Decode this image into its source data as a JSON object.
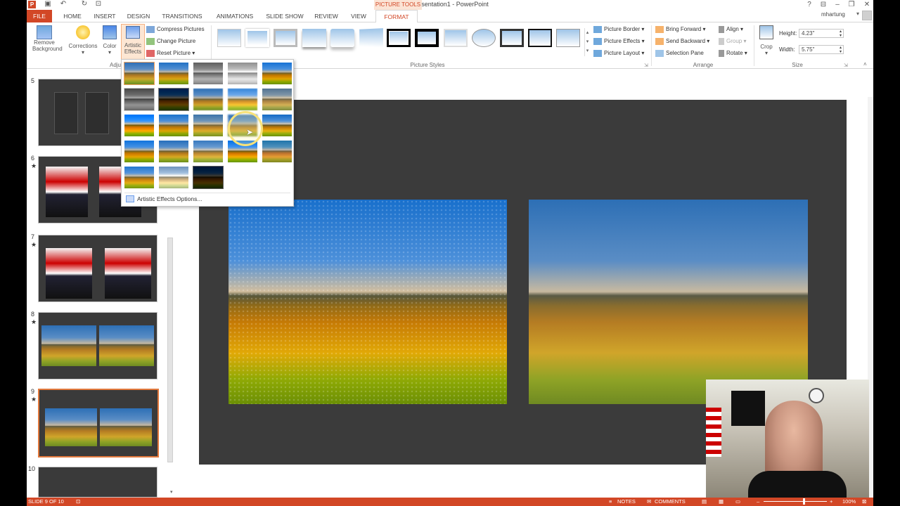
{
  "window": {
    "title": "Presentation1 - PowerPoint",
    "context_tab_group": "PICTURE TOOLS",
    "user": "mhartung",
    "help": "?",
    "minimize": "–",
    "restore": "❐",
    "close": "✕"
  },
  "tabs": [
    "FILE",
    "HOME",
    "INSERT",
    "DESIGN",
    "TRANSITIONS",
    "ANIMATIONS",
    "SLIDE SHOW",
    "REVIEW",
    "VIEW",
    "FORMAT"
  ],
  "ribbon": {
    "adjust": {
      "remove_background": "Remove\nBackground",
      "remove_bg_l1": "Remove",
      "remove_bg_l2": "Background",
      "corrections": "Corrections",
      "color": "Color",
      "artistic_l1": "Artistic",
      "artistic_l2": "Effects",
      "compress": "Compress Pictures",
      "change": "Change Picture",
      "reset": "Reset Picture",
      "group_label": "Adju"
    },
    "picture_styles": {
      "group_label": "Picture Styles",
      "border": "Picture Border",
      "effects": "Picture Effects",
      "layout": "Picture Layout"
    },
    "arrange": {
      "group_label": "Arrange",
      "bring_forward": "Bring Forward",
      "send_backward": "Send Backward",
      "selection_pane": "Selection Pane",
      "align": "Align",
      "group": "Group",
      "rotate": "Rotate"
    },
    "size": {
      "group_label": "Size",
      "crop": "Crop",
      "height_label": "Height:",
      "height_value": "4.23\"",
      "width_label": "Width:",
      "width_value": "5.75\""
    }
  },
  "artistic_effects": {
    "options_label": "Artistic Effects Options..."
  },
  "thumbnails": [
    {
      "num": "5",
      "star": ""
    },
    {
      "num": "6",
      "star": "★"
    },
    {
      "num": "7",
      "star": "★"
    },
    {
      "num": "8",
      "star": "★"
    },
    {
      "num": "9",
      "star": "★"
    },
    {
      "num": "10",
      "star": ""
    }
  ],
  "status": {
    "slide_info": "SLIDE 9 OF 10",
    "notes": "NOTES",
    "comments": "COMMENTS",
    "zoom": "100%"
  },
  "colors": {
    "accent": "#d24726",
    "slide_bg": "#3b3b3b",
    "selection": "#e2793d"
  }
}
